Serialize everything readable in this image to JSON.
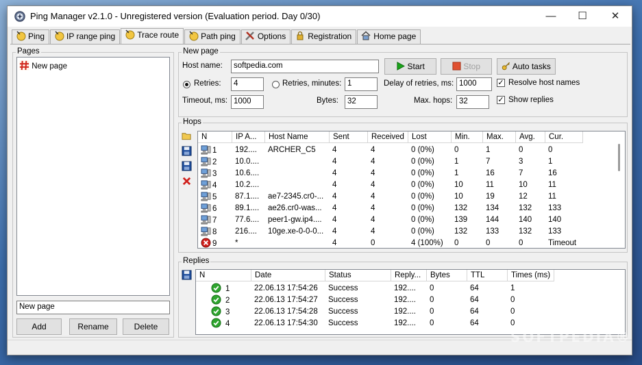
{
  "window": {
    "title": "Ping Manager v2.1.0 - Unregistered version (Evaluation period. Day 0/30)",
    "min_glyph": "—",
    "max_glyph": "☐",
    "close_glyph": "✕"
  },
  "tabs": [
    {
      "label": "Ping",
      "icon": "ping-icon"
    },
    {
      "label": "IP range ping",
      "icon": "ip-range-icon"
    },
    {
      "label": "Trace route",
      "icon": "trace-route-icon",
      "active": true
    },
    {
      "label": "Path ping",
      "icon": "path-ping-icon"
    },
    {
      "label": "Options",
      "icon": "tools-icon"
    },
    {
      "label": "Registration",
      "icon": "lock-icon"
    },
    {
      "label": "Home page",
      "icon": "home-icon"
    }
  ],
  "pages": {
    "group_label": "Pages",
    "items": [
      {
        "label": "New page",
        "icon": "page-hash-icon"
      }
    ],
    "name_value": "New page",
    "add_label": "Add",
    "rename_label": "Rename",
    "delete_label": "Delete"
  },
  "form": {
    "group_label": "New page",
    "host_label": "Host name:",
    "host_value": "softpedia.com",
    "start_label": "Start",
    "stop_label": "Stop",
    "auto_tasks_label": "Auto tasks",
    "retries_label": "Retries:",
    "retries_value": "4",
    "retries_min_label": "Retries, minutes:",
    "retries_min_value": "1",
    "delay_label": "Delay of retries, ms:",
    "delay_value": "1000",
    "resolve_label": "Resolve host names",
    "timeout_label": "Timeout, ms:",
    "timeout_value": "1000",
    "bytes_label": "Bytes:",
    "bytes_value": "32",
    "maxhops_label": "Max. hops:",
    "maxhops_value": "32",
    "show_replies_label": "Show replies",
    "check_glyph": "✓"
  },
  "hops": {
    "group_label": "Hops",
    "columns": [
      "N",
      "IP A...",
      "Host Name",
      "Sent",
      "Received",
      "Lost",
      "Min.",
      "Max.",
      "Avg.",
      "Cur."
    ],
    "rows": [
      {
        "n": "1",
        "ip": "192....",
        "host": "ARCHER_C5",
        "sent": "4",
        "received": "4",
        "lost": "0 (0%)",
        "min": "0",
        "max": "1",
        "avg": "0",
        "cur": "0",
        "status": "ok"
      },
      {
        "n": "2",
        "ip": "10.0....",
        "host": "",
        "sent": "4",
        "received": "4",
        "lost": "0 (0%)",
        "min": "1",
        "max": "7",
        "avg": "3",
        "cur": "1",
        "status": "ok"
      },
      {
        "n": "3",
        "ip": "10.6....",
        "host": "",
        "sent": "4",
        "received": "4",
        "lost": "0 (0%)",
        "min": "1",
        "max": "16",
        "avg": "7",
        "cur": "16",
        "status": "ok"
      },
      {
        "n": "4",
        "ip": "10.2....",
        "host": "",
        "sent": "4",
        "received": "4",
        "lost": "0 (0%)",
        "min": "10",
        "max": "11",
        "avg": "10",
        "cur": "11",
        "status": "ok"
      },
      {
        "n": "5",
        "ip": "87.1....",
        "host": "ae7-2345.cr0-...",
        "sent": "4",
        "received": "4",
        "lost": "0 (0%)",
        "min": "10",
        "max": "19",
        "avg": "12",
        "cur": "11",
        "status": "ok"
      },
      {
        "n": "6",
        "ip": "89.1....",
        "host": "ae26.cr0-was...",
        "sent": "4",
        "received": "4",
        "lost": "0 (0%)",
        "min": "132",
        "max": "134",
        "avg": "132",
        "cur": "133",
        "status": "ok"
      },
      {
        "n": "7",
        "ip": "77.6....",
        "host": "peer1-gw.ip4....",
        "sent": "4",
        "received": "4",
        "lost": "0 (0%)",
        "min": "139",
        "max": "144",
        "avg": "140",
        "cur": "140",
        "status": "ok"
      },
      {
        "n": "8",
        "ip": "216....",
        "host": "10ge.xe-0-0-0...",
        "sent": "4",
        "received": "4",
        "lost": "0 (0%)",
        "min": "132",
        "max": "133",
        "avg": "132",
        "cur": "133",
        "status": "ok"
      },
      {
        "n": "9",
        "ip": "*",
        "host": "",
        "sent": "4",
        "received": "0",
        "lost": "4 (100%)",
        "min": "0",
        "max": "0",
        "avg": "0",
        "cur": "Timeout",
        "status": "fail"
      }
    ]
  },
  "replies": {
    "group_label": "Replies",
    "columns": [
      "N",
      "Date",
      "Status",
      "Reply...",
      "Bytes",
      "TTL",
      "Times (ms)"
    ],
    "rows": [
      {
        "n": "1",
        "date": "22.06.13  17:54:26",
        "status": "Success",
        "reply": "192....",
        "bytes": "0",
        "ttl": "64",
        "times": "1"
      },
      {
        "n": "2",
        "date": "22.06.13  17:54:27",
        "status": "Success",
        "reply": "192....",
        "bytes": "0",
        "ttl": "64",
        "times": "0"
      },
      {
        "n": "3",
        "date": "22.06.13  17:54:28",
        "status": "Success",
        "reply": "192....",
        "bytes": "0",
        "ttl": "64",
        "times": "0"
      },
      {
        "n": "4",
        "date": "22.06.13  17:54:30",
        "status": "Success",
        "reply": "192....",
        "bytes": "0",
        "ttl": "64",
        "times": "0"
      }
    ]
  },
  "watermark": "SOFTPEDIA®",
  "colors": {
    "start_green": "#1aa31a",
    "stop_red": "#e05030",
    "error_red": "#d0201c",
    "success_green": "#2ea52e",
    "save_blue": "#1f4e9c"
  }
}
